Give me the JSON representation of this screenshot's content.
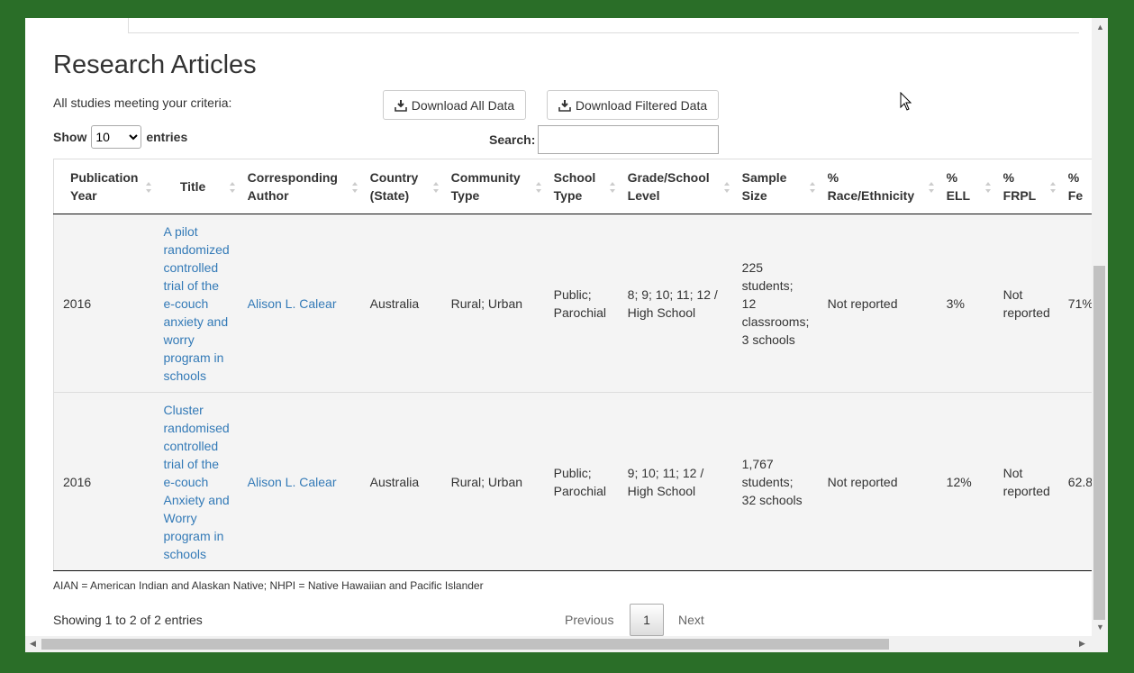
{
  "page": {
    "title": "Research Articles",
    "criteria": "All studies meeting your criteria:"
  },
  "toolbar": {
    "download_all": "Download All Data",
    "download_filtered": "Download Filtered Data"
  },
  "length": {
    "show": "Show",
    "value": "10",
    "entries": "entries"
  },
  "search": {
    "label": "Search:",
    "value": ""
  },
  "table": {
    "headers": [
      "Publication Year",
      "Title",
      "Corresponding Author",
      "Country (State)",
      "Community Type",
      "School Type",
      "Grade/School Level",
      "Sample Size",
      "% Race/Ethnicity",
      "% ELL",
      "% FRPL",
      "% Fe"
    ],
    "rows": [
      {
        "year": "2016",
        "title": "A pilot randomized controlled trial of the e-couch anxiety and worry program in schools",
        "author": "Alison L. Calear",
        "country": "Australia",
        "community": "Rural; Urban",
        "school_type": "Public; Parochial",
        "grade": "8; 9; 10; 11; 12 / High School",
        "sample": "225 students; 12 classrooms; 3 schools",
        "race": "Not reported",
        "ell": "3%",
        "frpl": "Not reported",
        "female": "71%"
      },
      {
        "year": "2016",
        "title": "Cluster randomised controlled trial of the e-couch Anxiety and Worry program in schools",
        "author": "Alison L. Calear",
        "country": "Australia",
        "community": "Rural; Urban",
        "school_type": "Public; Parochial",
        "grade": "9; 10; 11; 12 / High School",
        "sample": "1,767 students; 32 schools",
        "race": "Not reported",
        "ell": "12%",
        "frpl": "Not reported",
        "female": "62.8"
      }
    ]
  },
  "footnote": "AIAN = American Indian and Alaskan Native; NHPI = Native Hawaiian and Pacific Islander",
  "info": "Showing 1 to 2 of 2 entries",
  "pagination": {
    "previous": "Previous",
    "current": "1",
    "next": "Next"
  }
}
